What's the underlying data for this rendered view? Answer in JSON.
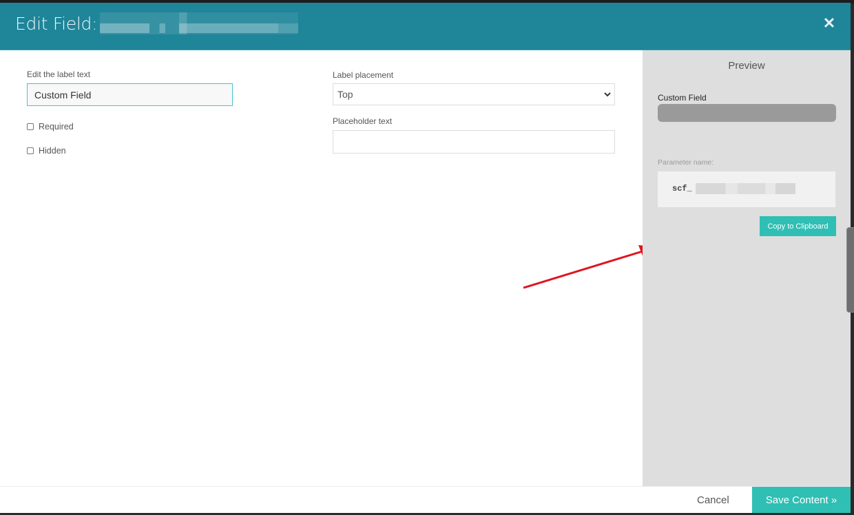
{
  "header": {
    "title": "Edit Field:",
    "title_redacted": true,
    "close_icon": "close-icon"
  },
  "form": {
    "label_text": {
      "label": "Edit the label text",
      "value": "Custom Field"
    },
    "required": {
      "label": "Required",
      "checked": false
    },
    "hidden": {
      "label": "Hidden",
      "checked": false
    },
    "label_placement": {
      "label": "Label placement",
      "selected": "Top",
      "icon": "chevron-down-icon"
    },
    "placeholder_text": {
      "label": "Placeholder text",
      "value": "",
      "placeholder": ""
    }
  },
  "preview": {
    "title": "Preview",
    "field_label": "Custom Field",
    "parameter_label": "Parameter name:",
    "parameter_value": "scf_",
    "parameter_redacted": true,
    "copy_button": "Copy to Clipboard"
  },
  "annotation": {
    "arrow_color": "#e0141e",
    "icon": "arrow-annotation-icon"
  },
  "footer": {
    "cancel": "Cancel",
    "save": "Save Content »"
  },
  "colors": {
    "header": "#1f8599",
    "accent": "#2fbfb4",
    "preview_bg": "#dedede"
  }
}
